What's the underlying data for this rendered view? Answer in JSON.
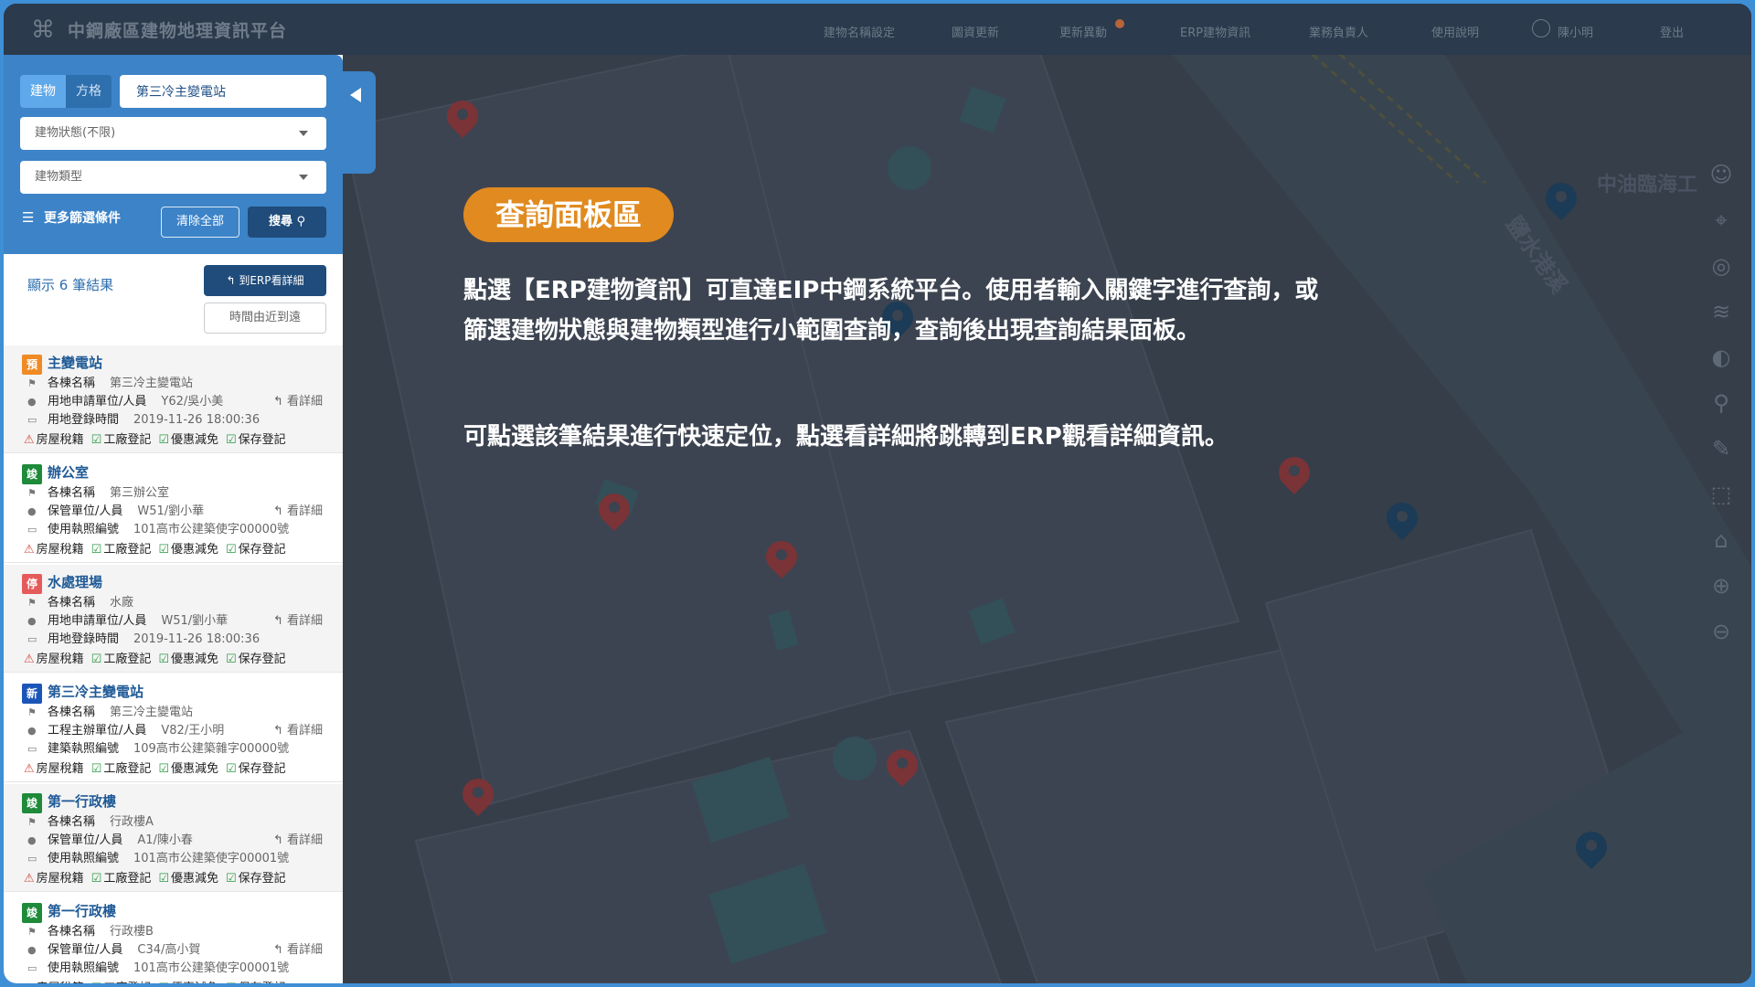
{
  "header": {
    "app_title": "中鋼廠區建物地理資訊平台",
    "nav": [
      "建物名稱設定",
      "圖資更新",
      "更新異動",
      "ERP建物資訊",
      "業務負責人",
      "使用說明"
    ],
    "user": "陳小明",
    "logout": "登出"
  },
  "search": {
    "tab_building": "建物",
    "tab_grid": "方格",
    "query": "第三冷主變電站",
    "status_select": "建物狀態(不限)",
    "type_select": "建物類型",
    "more_filters": "更多篩選條件",
    "clear": "清除全部",
    "search": "搜尋"
  },
  "results": {
    "count_text": "顯示 6 筆結果",
    "erp_button": "到ERP看詳細",
    "sort_button": "時間由近到遠",
    "detail_label": "看詳細",
    "tags": [
      "房屋稅籍",
      "工廠登記",
      "優惠減免",
      "保存登記"
    ],
    "items": [
      {
        "badge": "預",
        "badge_color": "#f08a24",
        "name": "主變電站",
        "l1k": "各棟名稱",
        "l1v": "第三冷主變電站",
        "l2k": "用地申請單位/人員",
        "l2v": "Y62/吳小美",
        "l3k": "用地登錄時間",
        "l3v": "2019-11-26 18:00:36"
      },
      {
        "badge": "竣",
        "badge_color": "#1e8a3a",
        "name": "辦公室",
        "l1k": "各棟名稱",
        "l1v": "第三辦公室",
        "l2k": "保管單位/人員",
        "l2v": "W51/劉小華",
        "l3k": "使用執照編號",
        "l3v": "101高市公建築使字00000號"
      },
      {
        "badge": "停",
        "badge_color": "#e55b5b",
        "name": "水處理場",
        "l1k": "各棟名稱",
        "l1v": "水廠",
        "l2k": "用地申請單位/人員",
        "l2v": "W51/劉小華",
        "l3k": "用地登錄時間",
        "l3v": "2019-11-26 18:00:36"
      },
      {
        "badge": "新",
        "badge_color": "#1c55b8",
        "name": "第三冷主變電站",
        "l1k": "各棟名稱",
        "l1v": "第三冷主變電站",
        "l2k": "工程主辦單位/人員",
        "l2v": "V82/王小明",
        "l3k": "建築執照編號",
        "l3v": "109高市公建築雜字00000號"
      },
      {
        "badge": "竣",
        "badge_color": "#1e8a3a",
        "name": "第一行政樓",
        "l1k": "各棟名稱",
        "l1v": "行政樓A",
        "l2k": "保管單位/人員",
        "l2v": "A1/陳小春",
        "l3k": "使用執照編號",
        "l3v": "101高市公建築使字00001號"
      },
      {
        "badge": "竣",
        "badge_color": "#1e8a3a",
        "name": "第一行政樓",
        "l1k": "各棟名稱",
        "l1v": "行政樓B",
        "l2k": "保管單位/人員",
        "l2v": "C34/高小賀",
        "l3k": "使用執照編號",
        "l3v": "101高市公建築使字00001號"
      }
    ]
  },
  "tutorial": {
    "pill": "查詢面板區",
    "para1": "點選【ERP建物資訊】可直達EIP中鋼系統平台。使用者輸入關鍵字進行查詢，或篩選建物狀態與建物類型進行小範圍查詢，查詢後出現查詢結果面板。",
    "para2": "可點選該筆結果進行快速定位，點選看詳細將跳轉到ERP觀看詳細資訊。"
  },
  "map": {
    "label_port": "中油臨海工",
    "label_channel": "鹽水港溪"
  },
  "colors": {
    "header_bg": "#2b3a4c",
    "panel_blue": "#3c83c8",
    "dark_button": "#1f4c7b",
    "pill_orange": "#e08a1f",
    "pin_red": "#7a3336",
    "pin_blue": "#1b3b56"
  }
}
